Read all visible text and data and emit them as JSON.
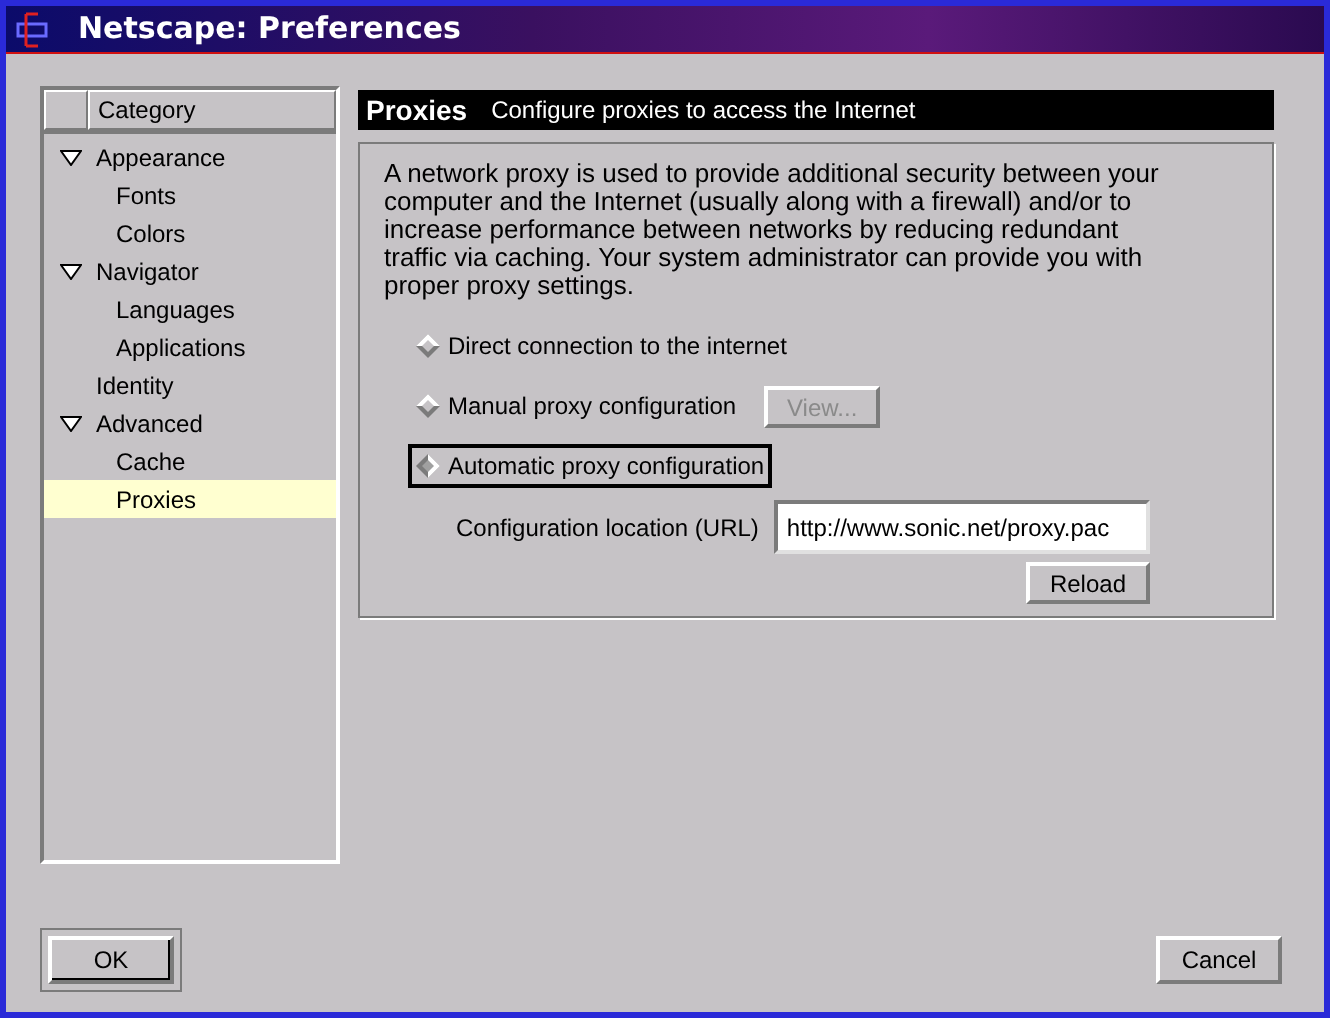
{
  "window": {
    "title": "Netscape: Preferences"
  },
  "sidebar": {
    "header": "Category",
    "items": [
      {
        "label": "Appearance",
        "expanded": true,
        "selected": false,
        "children": [
          {
            "label": "Fonts",
            "selected": false
          },
          {
            "label": "Colors",
            "selected": false
          }
        ]
      },
      {
        "label": "Navigator",
        "expanded": true,
        "selected": false,
        "children": [
          {
            "label": "Languages",
            "selected": false
          },
          {
            "label": "Applications",
            "selected": false
          }
        ]
      },
      {
        "label": "Identity",
        "selected": false
      },
      {
        "label": "Advanced",
        "expanded": true,
        "selected": false,
        "children": [
          {
            "label": "Cache",
            "selected": false
          },
          {
            "label": "Proxies",
            "selected": true
          }
        ]
      }
    ]
  },
  "panel": {
    "title": "Proxies",
    "subtitle": "Configure proxies to access the Internet",
    "description": "A network proxy is used to provide additional security between your computer and the Internet (usually along with a firewall) and/or to increase performance between networks by reducing redundant traffic via caching. Your system administrator can provide you with proper proxy settings.",
    "options": [
      {
        "label": "Direct connection to the internet",
        "selected": false,
        "focused": false
      },
      {
        "label": "Manual proxy configuration",
        "selected": false,
        "focused": false,
        "button": {
          "label": "View...",
          "disabled": true
        }
      },
      {
        "label": "Automatic proxy configuration",
        "selected": true,
        "focused": true
      }
    ],
    "url_label": "Configuration location (URL)",
    "url_value": "http://www.sonic.net/proxy.pac",
    "reload_button": "Reload"
  },
  "buttons": [
    {
      "label": "OK",
      "default": true
    },
    {
      "label": "Cancel",
      "default": false
    }
  ]
}
